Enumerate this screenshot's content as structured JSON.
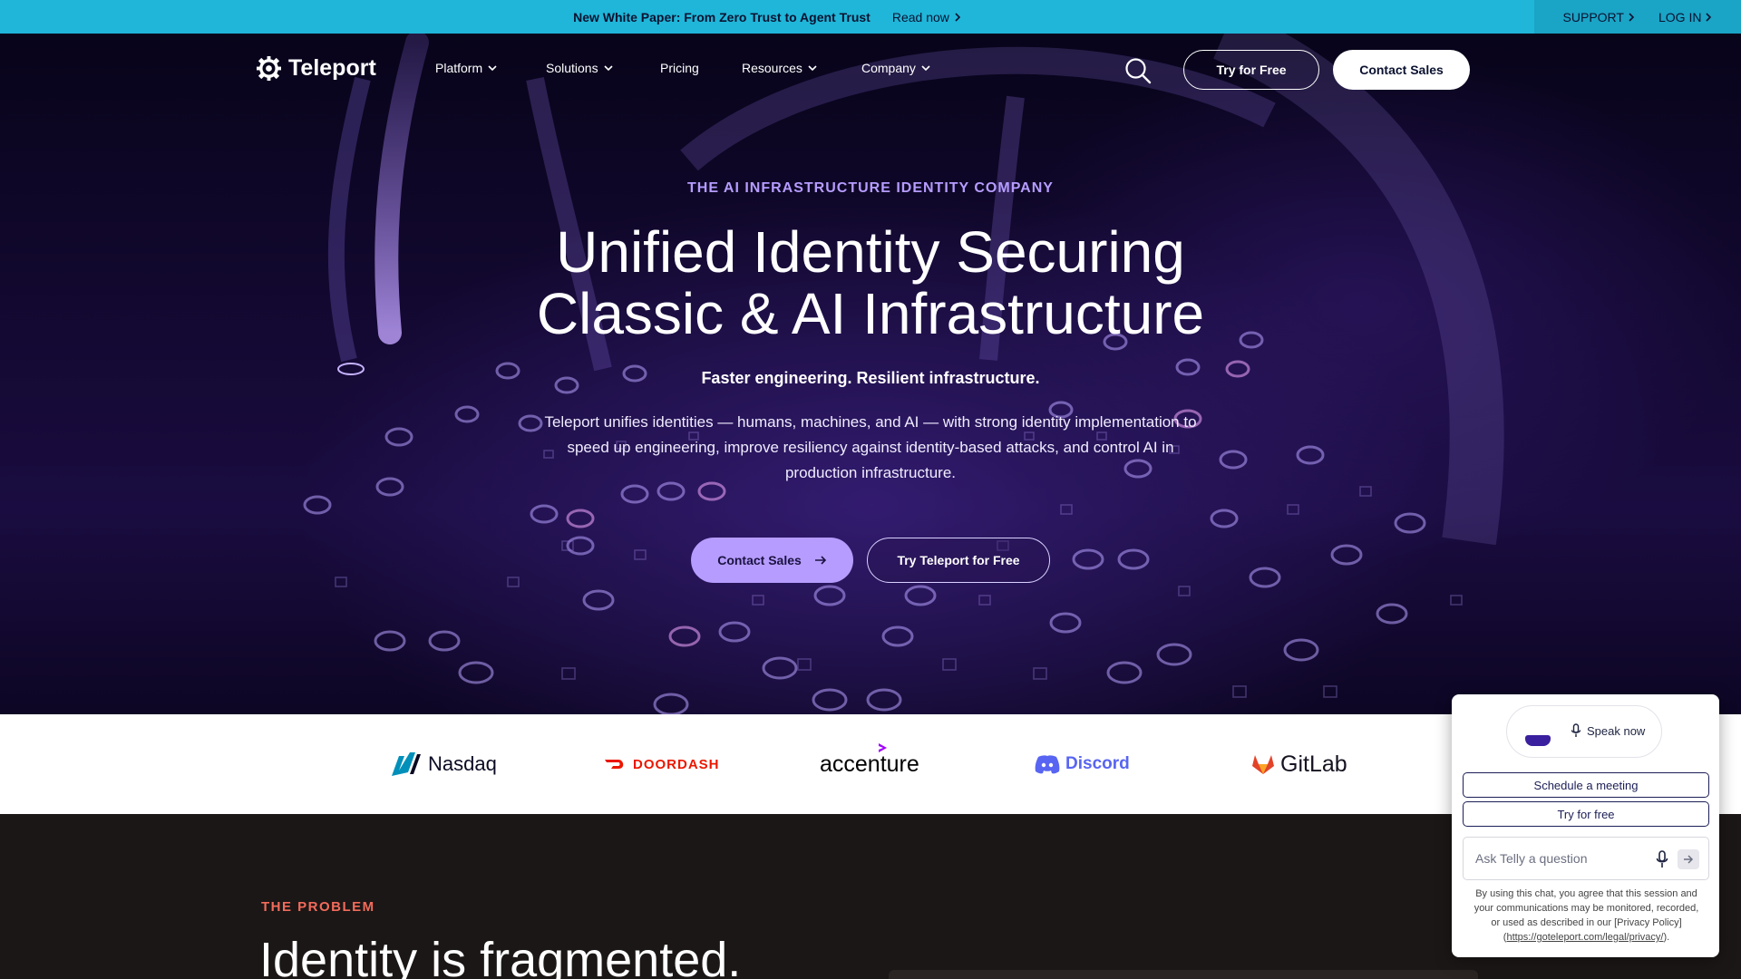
{
  "announcement": {
    "text": "New White Paper: From Zero Trust to Agent Trust",
    "link": "Read now",
    "support": "SUPPORT",
    "login": "LOG IN"
  },
  "nav": {
    "brand": "Teleport",
    "items": [
      {
        "label": "Platform",
        "dropdown": true
      },
      {
        "label": "Solutions",
        "dropdown": true
      },
      {
        "label": "Pricing",
        "dropdown": false
      },
      {
        "label": "Resources",
        "dropdown": true
      },
      {
        "label": "Company",
        "dropdown": true
      }
    ],
    "try_free": "Try for Free",
    "contact_sales": "Contact Sales"
  },
  "hero": {
    "eyebrow": "THE AI INFRASTRUCTURE IDENTITY COMPANY",
    "title_line1": "Unified Identity Securing",
    "title_line2": "Classic & AI Infrastructure",
    "subtitle": "Faster engineering. Resilient infrastructure.",
    "description": "Teleport unifies identities — humans, machines, and AI — with strong identity implementation to speed up engineering, improve resiliency against identity-based attacks, and control AI in production infrastructure.",
    "primary_cta": "Contact Sales",
    "secondary_cta": "Try Teleport for Free"
  },
  "logos": [
    {
      "name": "Nasdaq",
      "color": "#0a0a23"
    },
    {
      "name": "DOORDASH",
      "color": "#eb1700"
    },
    {
      "name": "accenture",
      "color": "#000000"
    },
    {
      "name": "Discord",
      "color": "#5865f2"
    },
    {
      "name": "GitLab",
      "color": "#171321"
    }
  ],
  "problem": {
    "eyebrow": "THE PROBLEM",
    "title": "Identity is fragmented."
  },
  "chat": {
    "speak": "Speak now",
    "schedule": "Schedule a meeting",
    "try_free": "Try for free",
    "placeholder": "Ask Telly a question",
    "legal_prefix": "By using this chat, you agree that this session and your communications may be monitored, recorded, or used as described in our [Privacy Policy] (",
    "legal_link": "https://goteleport.com/legal/privacy/",
    "legal_suffix": ")."
  },
  "colors": {
    "announce_bg": "#1fb6d9",
    "accent": "#b69cff",
    "problem_accent": "#f26b5b",
    "hero_bg": "#140933"
  }
}
